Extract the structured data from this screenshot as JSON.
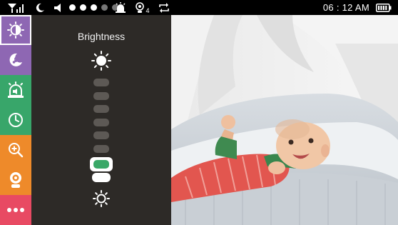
{
  "status_bar": {
    "time": "06 : 12 AM",
    "camera_count": "4",
    "icons": [
      "signal-icon",
      "moon-icon",
      "speaker-icon",
      "alarm-icon",
      "camera-icon",
      "repeat-icon",
      "battery-icon"
    ],
    "volume_level": 3,
    "volume_max": 5
  },
  "sidebar": {
    "items": [
      {
        "name": "brightness",
        "icon": "brightness-icon",
        "color": "#8e67b3",
        "selected": true
      },
      {
        "name": "lullaby",
        "icon": "lullaby-icon",
        "color": "#8e67b3",
        "selected": false
      },
      {
        "name": "alarm",
        "icon": "alarm-icon",
        "color": "#38a66a",
        "selected": false
      },
      {
        "name": "timer",
        "icon": "clock-icon",
        "color": "#38a66a",
        "selected": false
      },
      {
        "name": "zoom",
        "icon": "zoom-icon",
        "color": "#ee8a2a",
        "selected": false
      },
      {
        "name": "camera",
        "icon": "camera-icon",
        "color": "#ee8a2a",
        "selected": false
      },
      {
        "name": "more",
        "icon": "more-icon",
        "color": "#e84a63",
        "selected": false
      }
    ]
  },
  "brightness": {
    "title": "Brightness",
    "level": 2,
    "max_level": 8,
    "active_color": "#39a867",
    "inactive_color": "#5d5955"
  },
  "camera_view": {
    "scene": "baby-in-crib"
  }
}
